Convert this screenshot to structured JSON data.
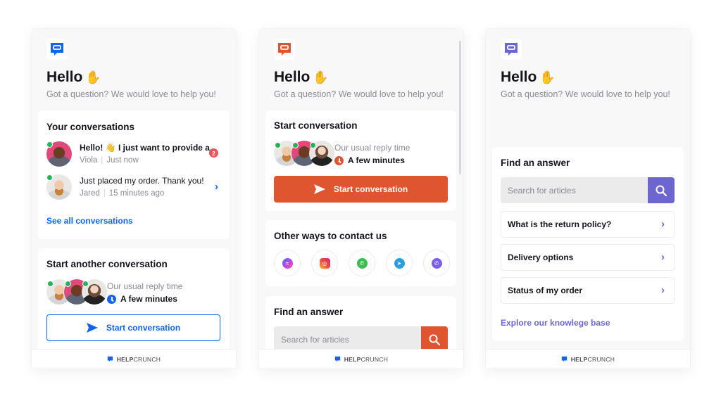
{
  "brand": {
    "name_bold": "HELP",
    "name_light": "CRUNCH"
  },
  "widgets": [
    {
      "theme": "blue",
      "accent": "#1264f0",
      "greeting": "Hello",
      "greeting_emoji": "✋",
      "subtitle": "Got a question? We would love to help you!",
      "conversations": {
        "title": "Your conversations",
        "items": [
          {
            "message": "Hello! 👋 I just want to provide a...",
            "author": "Viola",
            "time": "Just now",
            "unread": "2",
            "bold": true
          },
          {
            "message": "Just placed my order. Thank you!",
            "author": "Jared",
            "time": "15 minutes ago",
            "unread": null,
            "bold": false
          }
        ],
        "see_all": "See all conversations"
      },
      "start": {
        "title": "Start another conversation",
        "reply_label": "Our usual reply time",
        "reply_value": "A few minutes",
        "button": "Start conversation"
      }
    },
    {
      "theme": "orange",
      "accent": "#de5530",
      "greeting": "Hello",
      "greeting_emoji": "✋",
      "subtitle": "Got a question? We would love to help you!",
      "start": {
        "title": "Start conversation",
        "reply_label": "Our usual reply time",
        "reply_value": "A few minutes",
        "button": "Start conversation"
      },
      "contact": {
        "title": "Other ways to contact us",
        "channels": [
          {
            "name": "messenger",
            "icon": "messenger-icon",
            "color": "#8a4dfa",
            "glyph": "≈"
          },
          {
            "name": "instagram",
            "icon": "instagram-icon",
            "color": "#ee4a3a",
            "glyph": "◎"
          },
          {
            "name": "whatsapp",
            "icon": "whatsapp-icon",
            "color": "#3dbb4e",
            "glyph": "✆"
          },
          {
            "name": "telegram",
            "icon": "telegram-icon",
            "color": "#2a9ee0",
            "glyph": "➤"
          },
          {
            "name": "viber",
            "icon": "viber-icon",
            "color": "#7b5de8",
            "glyph": "✆"
          }
        ]
      },
      "kb": {
        "title": "Find an answer",
        "search_placeholder": "Search for articles"
      }
    },
    {
      "theme": "purple",
      "accent": "#6e66cf",
      "greeting": "Hello",
      "greeting_emoji": "✋",
      "subtitle": "Got a question? We would love to help you!",
      "kb": {
        "title": "Find an answer",
        "search_placeholder": "Search for articles",
        "articles": [
          "What is the return policy?",
          "Delivery options",
          "Status of my order"
        ],
        "explore": "Explore our knowlege base"
      }
    }
  ]
}
